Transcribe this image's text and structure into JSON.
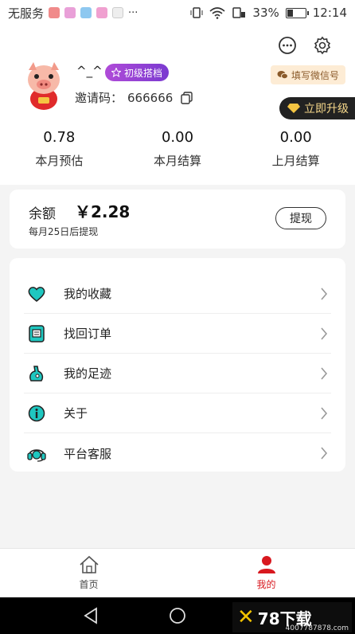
{
  "status_bar": {
    "carrier": "无服务",
    "battery": "33%",
    "battery_level": 0.33,
    "time": "12:14",
    "more": "···"
  },
  "header": {
    "wechat_label": "填写微信号",
    "upgrade_label": "立即升级",
    "nickname": "^_^",
    "level_label": "初级搭档",
    "invite_label": "邀请码：",
    "invite_code": "666666"
  },
  "stats": [
    {
      "value": "0.78",
      "label": "本月预估"
    },
    {
      "value": "0.00",
      "label": "本月结算"
    },
    {
      "value": "0.00",
      "label": "上月结算"
    }
  ],
  "balance": {
    "label": "余额",
    "amount": "￥2.28",
    "note": "每月25日后提现",
    "withdraw_label": "提现"
  },
  "menu": [
    {
      "label": "我的收藏",
      "icon": "heart-icon"
    },
    {
      "label": "找回订单",
      "icon": "order-icon"
    },
    {
      "label": "我的足迹",
      "icon": "footprint-icon"
    },
    {
      "label": "关于",
      "icon": "info-icon"
    },
    {
      "label": "平台客服",
      "icon": "headset-icon"
    }
  ],
  "tabbar": {
    "home_label": "首页",
    "mine_label": "我的"
  },
  "watermark": {
    "text": "78下载",
    "url": "4007787878.com"
  },
  "colors": {
    "accent": "#d8181f",
    "teal": "#1fc7c0",
    "badge": "#9b45d6"
  }
}
